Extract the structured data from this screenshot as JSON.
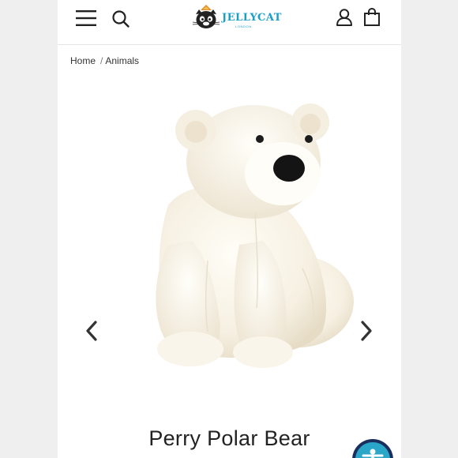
{
  "header": {
    "brand": "JELLYCAT",
    "brand_sub": "LONDON",
    "icons": {
      "menu": "hamburger-menu-icon",
      "search": "search-icon",
      "account": "user-icon",
      "bag": "shopping-bag-icon"
    }
  },
  "breadcrumb": {
    "items": [
      "Home",
      "Animals"
    ],
    "separator": "/"
  },
  "product": {
    "title": "Perry Polar Bear",
    "image": "white polar bear plush"
  },
  "colors": {
    "brand": "#1aa0c8",
    "accessibility_button": "#2aa6c9"
  }
}
